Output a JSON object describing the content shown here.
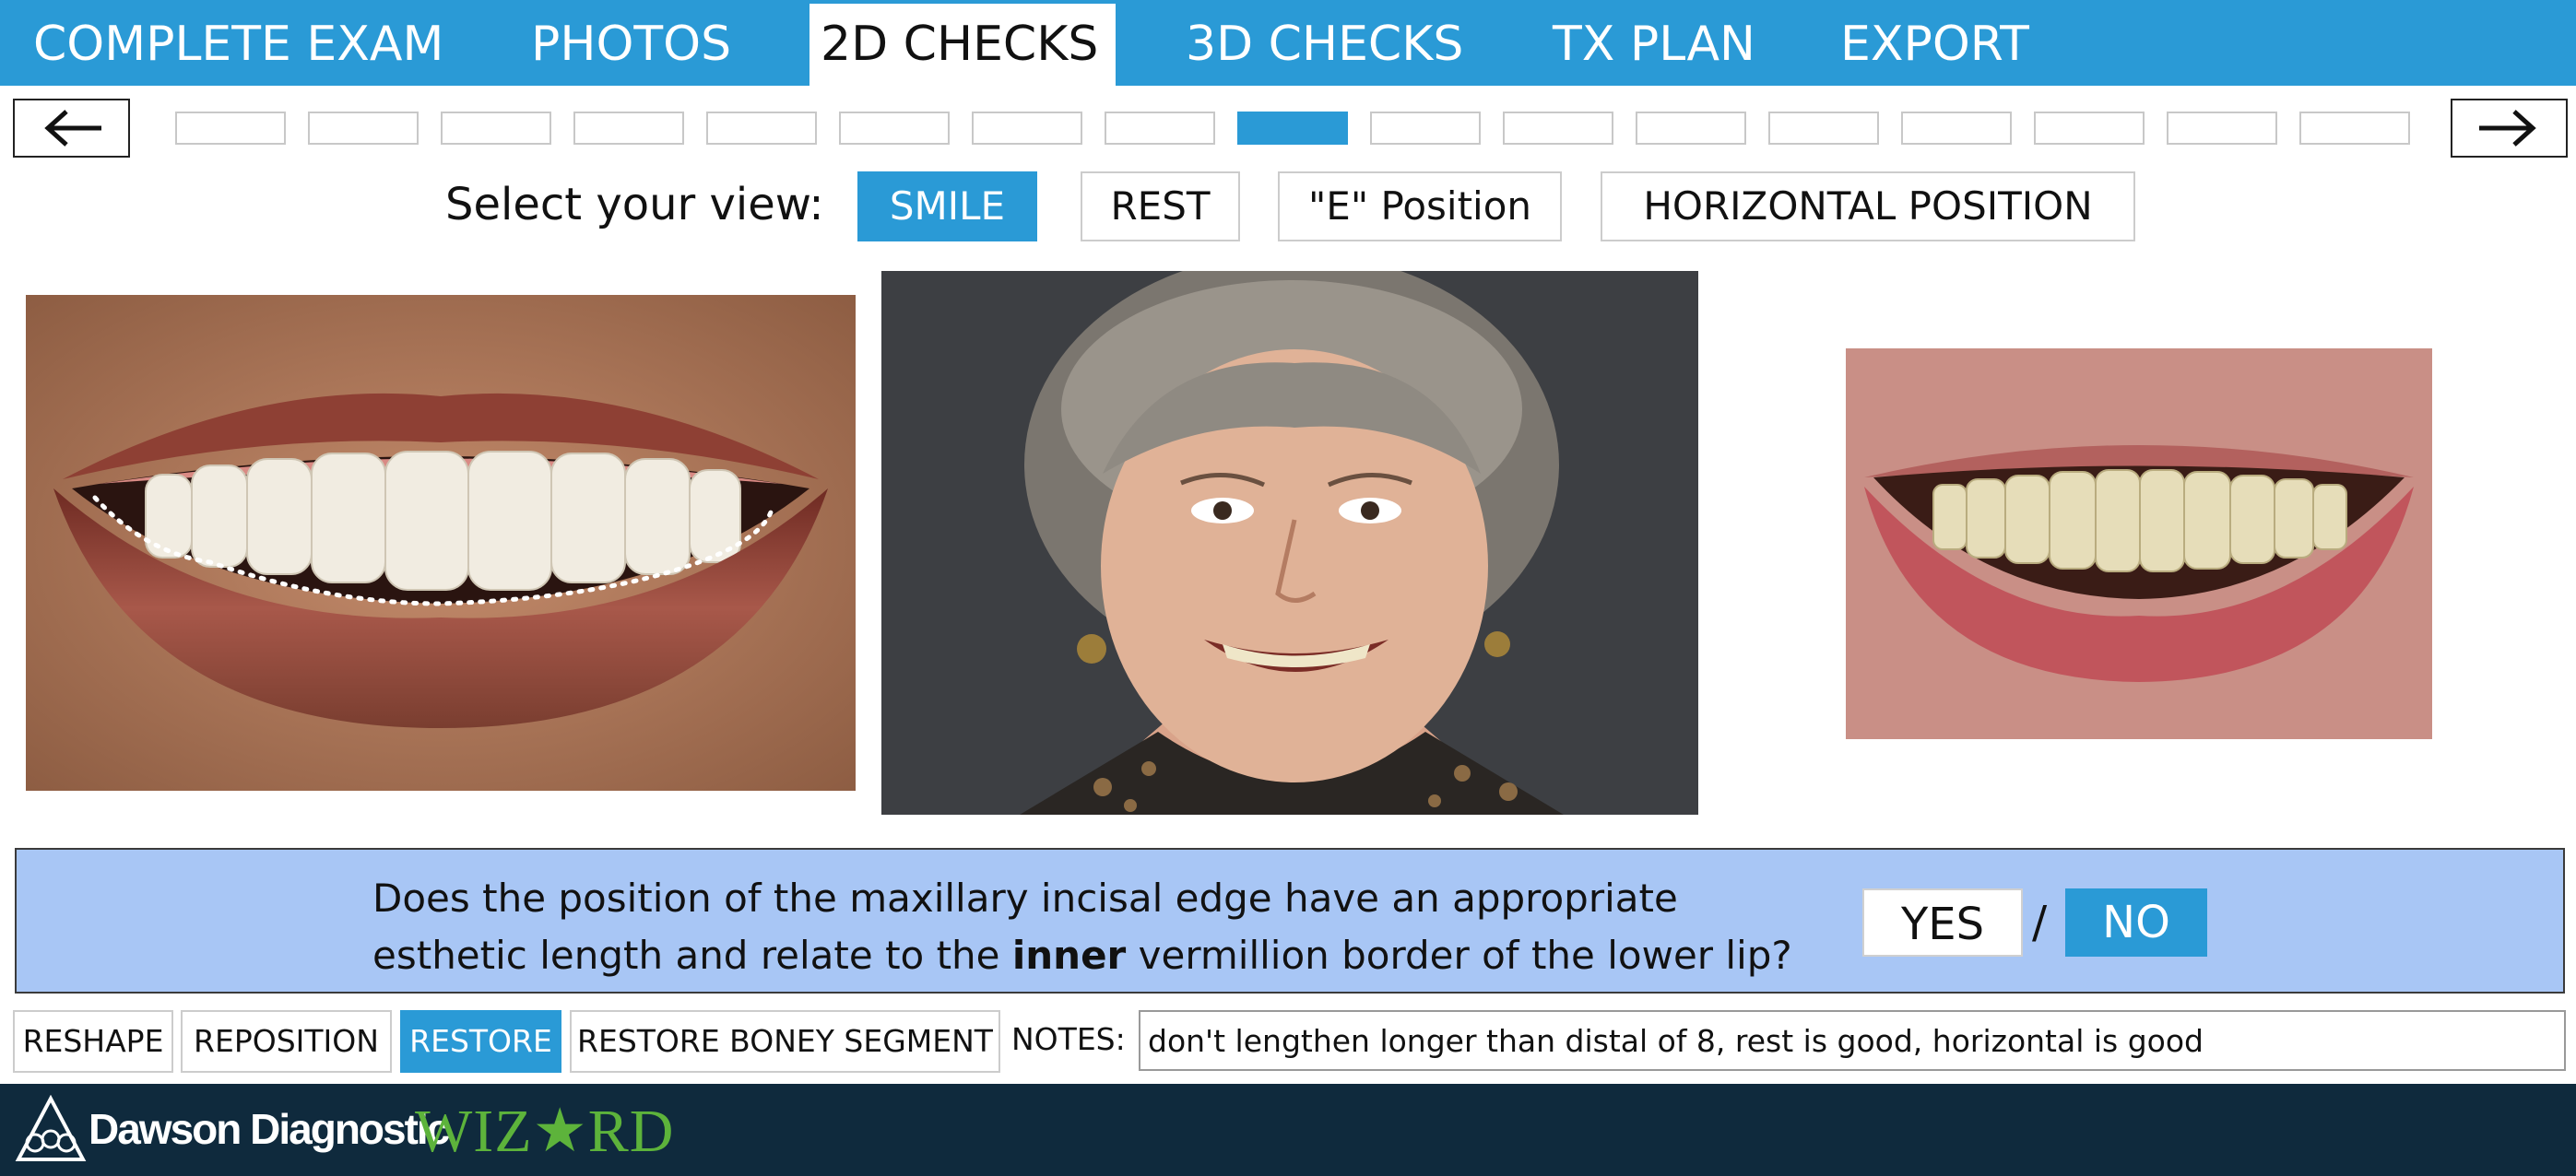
{
  "nav": {
    "tabs": [
      {
        "label": "COMPLETE EXAM",
        "active": false
      },
      {
        "label": "PHOTOS",
        "active": false
      },
      {
        "label": "2D CHECKS",
        "active": true
      },
      {
        "label": "3D CHECKS",
        "active": false
      },
      {
        "label": "TX PLAN",
        "active": false
      },
      {
        "label": "EXPORT",
        "active": false
      }
    ]
  },
  "stepper": {
    "prev_icon": "arrow-left-icon",
    "next_icon": "arrow-right-icon",
    "step_count": 17,
    "active_step": 9
  },
  "view_selector": {
    "label": "Select your view:",
    "options": [
      {
        "label": "SMILE",
        "active": true
      },
      {
        "label": "REST",
        "active": false
      },
      {
        "label": "\"E\" Position",
        "active": false
      },
      {
        "label": "HORIZONTAL POSITION",
        "active": false
      }
    ]
  },
  "question": {
    "line1": "Does the position of the maxillary incisal edge have an appropriate",
    "line2_pre": "esthetic length and relate to the ",
    "line2_bold": "inner",
    "line2_post": " vermillion border of the lower lip?",
    "yes_label": "YES",
    "separator": "/",
    "no_label": "NO",
    "selected": "NO"
  },
  "actions": {
    "buttons": [
      {
        "label": "RESHAPE",
        "active": false
      },
      {
        "label": "REPOSITION",
        "active": false
      },
      {
        "label": "RESTORE",
        "active": true
      },
      {
        "label": "RESTORE BONEY SEGMENT",
        "active": false
      }
    ],
    "notes_label": "NOTES:",
    "notes_value": "don't lengthen longer than distal of 8, rest is good, horizontal is good"
  },
  "footer": {
    "brand": "Dawson Diagnostic",
    "brand_accent": "WIZ★RD"
  },
  "colors": {
    "accent": "#2a9ad6",
    "question_bg": "#a8c6f5",
    "footer_bg": "#0f2a3d",
    "brand_green": "#5db33b"
  }
}
